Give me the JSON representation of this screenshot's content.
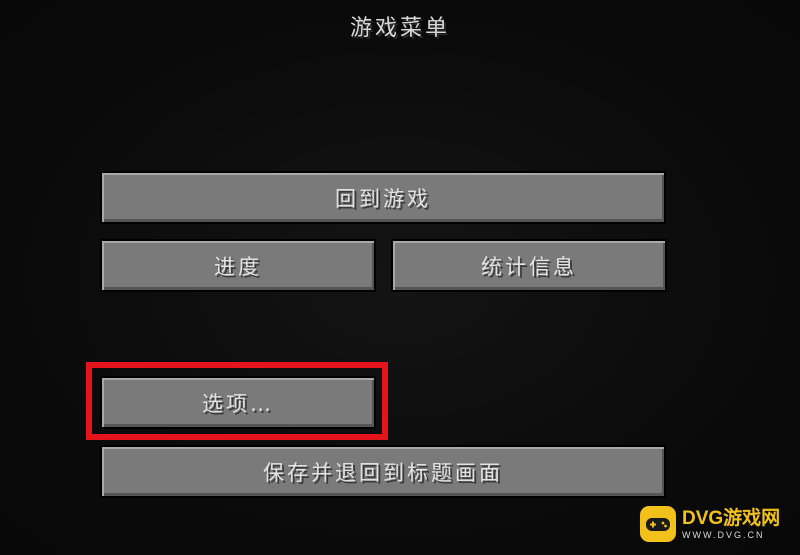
{
  "menu": {
    "title": "游戏菜单",
    "back_to_game": "回到游戏",
    "advancements": "进度",
    "statistics": "统计信息",
    "options": "选项…",
    "save_and_quit": "保存并退回到标题画面"
  },
  "watermark": {
    "brand": "DVG游戏网",
    "site": "WWW.DVG.CN"
  },
  "colors": {
    "highlight": "#e3141b",
    "button": "#7a7a7a",
    "watermark_accent": "#f2c21b"
  }
}
